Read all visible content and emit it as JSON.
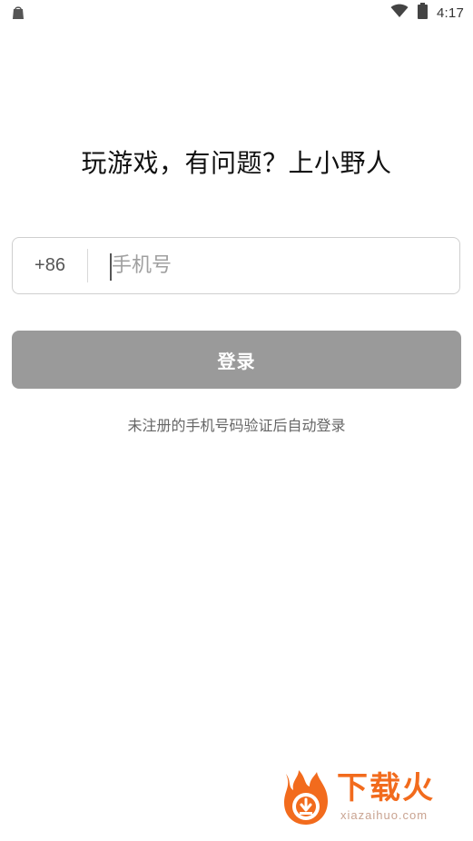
{
  "status_bar": {
    "left_icon": "shopping-bag-icon",
    "wifi_icon": "wifi-icon",
    "battery_icon": "battery-icon",
    "time": "4:17"
  },
  "main": {
    "title": "玩游戏，有问题？上小野人",
    "country_code": "+86",
    "phone_placeholder": "手机号",
    "phone_value": "",
    "login_label": "登录",
    "hint": "未注册的手机号码验证后自动登录"
  },
  "watermark": {
    "brand": "下载火",
    "url": "xiazaihuo.com",
    "icon": "flame-download-icon"
  },
  "colors": {
    "button_disabled": "#9a9a9a",
    "brand_orange": "#f26b1d"
  }
}
